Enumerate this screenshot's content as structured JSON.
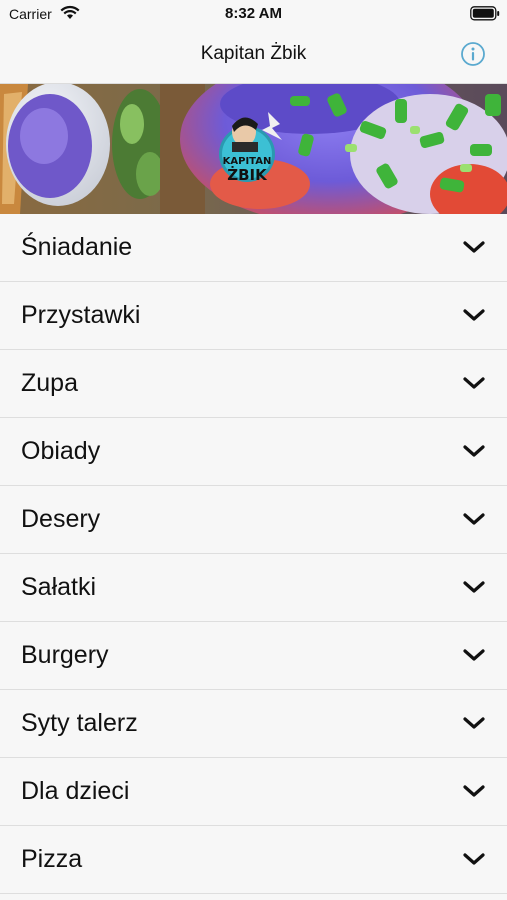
{
  "status_bar": {
    "carrier": "Carrier",
    "time": "8:32 AM",
    "icons": [
      "wifi-icon",
      "battery-icon"
    ]
  },
  "nav": {
    "title": "Kapitan Żbik",
    "info_icon": "info-circle-icon",
    "accent_color": "#5aa9cf"
  },
  "banner": {
    "logo_text_line1": "KAPITAN",
    "logo_text_line2": "ŻBIK"
  },
  "menu": {
    "items": [
      {
        "label": "Śniadanie"
      },
      {
        "label": "Przystawki"
      },
      {
        "label": "Zupa"
      },
      {
        "label": "Obiady"
      },
      {
        "label": "Desery"
      },
      {
        "label": "Sałatki"
      },
      {
        "label": "Burgery"
      },
      {
        "label": "Syty talerz"
      },
      {
        "label": "Dla dzieci"
      },
      {
        "label": "Pizza"
      }
    ],
    "chevron_icon": "chevron-down-icon"
  }
}
